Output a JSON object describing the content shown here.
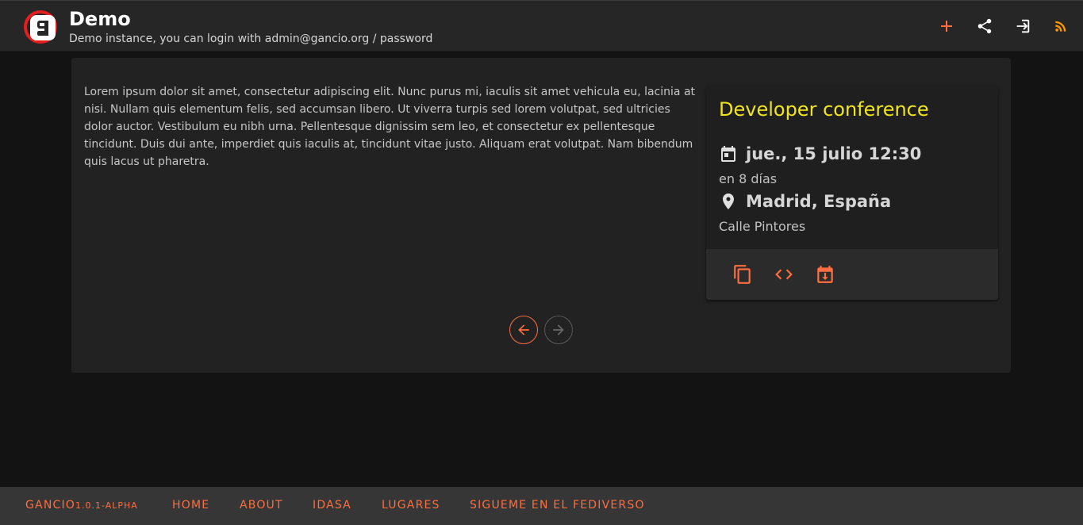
{
  "header": {
    "title": "Demo",
    "subtitle": "Demo instance, you can login with admin@gancio.org / password",
    "actions": [
      "add-icon",
      "share-icon",
      "login-icon",
      "rss-icon"
    ]
  },
  "content": {
    "description": "Lorem ipsum dolor sit amet, consectetur adipiscing elit. Nunc purus mi, iaculis sit amet vehicula eu, lacinia at nisi. Nullam quis elementum felis, sed accumsan libero. Ut viverra turpis sed lorem volutpat, sed ultricies dolor auctor. Vestibulum eu nibh urna. Pellentesque dignissim sem leo, et consectetur ex pellentesque tincidunt. Duis dui ante, imperdiet quis iaculis at, tincidunt vitae justo. Aliquam erat volutpat. Nam bibendum quis lacus ut pharetra."
  },
  "event": {
    "title": "Developer conference",
    "date": "jue., 15 julio 12:30",
    "relative": "en 8 días",
    "place": "Madrid, España",
    "address": "Calle Pintores",
    "actions": [
      "copy-icon",
      "embed-code-icon",
      "calendar-download-icon"
    ]
  },
  "footer": {
    "brand": "Gancio",
    "version": "1.0.1-alpha",
    "links": [
      "Home",
      "About",
      "IDASA",
      "Lugares",
      "Sigueme en el fediverso"
    ]
  },
  "colors": {
    "accent": "#ff6e40",
    "event_title": "#f2e51c",
    "rss": "#ff9800",
    "background": "#131313",
    "card": "#222222"
  }
}
